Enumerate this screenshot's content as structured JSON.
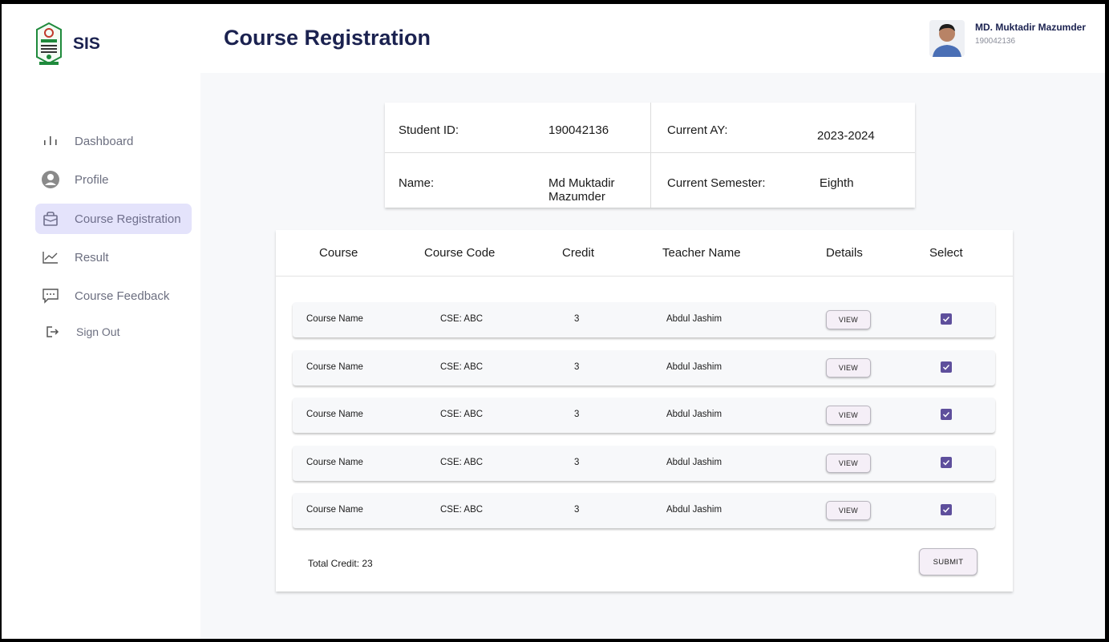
{
  "app": {
    "name": "SIS"
  },
  "header": {
    "title": "Course Registration",
    "user_name": "MD. Muktadir Mazumder",
    "user_id": "190042136"
  },
  "sidebar": {
    "items": [
      {
        "label": "Dashboard",
        "icon": "bar-chart-icon",
        "active": false
      },
      {
        "label": "Profile",
        "icon": "user-circle-icon",
        "active": false
      },
      {
        "label": "Course Registration",
        "icon": "bag-icon",
        "active": true
      },
      {
        "label": "Result",
        "icon": "line-chart-icon",
        "active": false
      },
      {
        "label": "Course Feedback",
        "icon": "message-icon",
        "active": false
      },
      {
        "label": "Sign Out",
        "icon": "sign-out-icon",
        "active": false
      }
    ]
  },
  "student_info": {
    "id_label": "Student ID:",
    "id_value": "190042136",
    "ay_label": "Current AY:",
    "ay_value": "2023-2024",
    "name_label": "Name:",
    "name_value_line1": "Md Muktadir",
    "name_value_line2": "Mazumder",
    "semester_label": "Current Semester:",
    "semester_value": "Eighth"
  },
  "course_table": {
    "headers": [
      "Course",
      "Course Code",
      "Credit",
      "Teacher Name",
      "Details",
      "Select"
    ],
    "rows": [
      {
        "course": "Course Name",
        "code": "CSE: ABC",
        "credit": "3",
        "teacher": "Abdul Jashim",
        "details": "VIEW",
        "selected": true
      },
      {
        "course": "Course Name",
        "code": "CSE: ABC",
        "credit": "3",
        "teacher": "Abdul Jashim",
        "details": "VIEW",
        "selected": true
      },
      {
        "course": "Course Name",
        "code": "CSE: ABC",
        "credit": "3",
        "teacher": "Abdul Jashim",
        "details": "VIEW",
        "selected": true
      },
      {
        "course": "Course Name",
        "code": "CSE: ABC",
        "credit": "3",
        "teacher": "Abdul Jashim",
        "details": "VIEW",
        "selected": true
      },
      {
        "course": "Course Name",
        "code": "CSE: ABC",
        "credit": "3",
        "teacher": "Abdul Jashim",
        "details": "VIEW",
        "selected": true
      }
    ],
    "total_credit": "Total Credit: 23",
    "submit_label": "SUBMIT"
  },
  "colors": {
    "accent": "#5e4f9c",
    "active_nav_bg": "#e4e3fb",
    "title": "#1b2250"
  }
}
